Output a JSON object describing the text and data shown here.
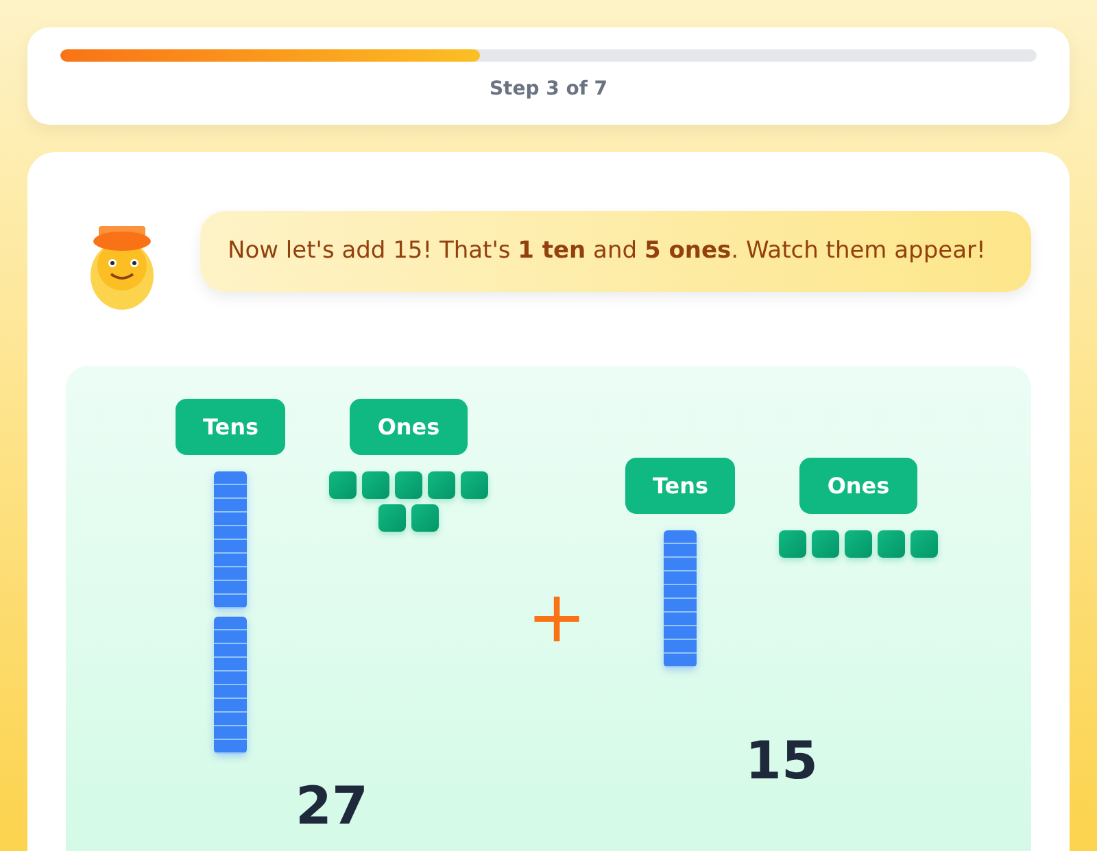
{
  "progress": {
    "level": 0.43,
    "label": "Step 3 of 7"
  },
  "message": "Now let's add 15! That's **1 ten** and **5 ones**. Watch them appear!",
  "numbers": [
    {
      "tens": {
        "label": "Tens",
        "blocks": [
          {
            "kind": "rod"
          },
          {
            "kind": "rod"
          }
        ]
      },
      "ones": {
        "label": "Ones",
        "blocks": [
          {
            "kind": "cube"
          },
          {
            "kind": "cube"
          },
          {
            "kind": "cube"
          },
          {
            "kind": "cube"
          },
          {
            "kind": "cube"
          },
          {
            "kind": "cube"
          },
          {
            "kind": "cube"
          }
        ]
      },
      "value": "27"
    },
    {
      "tens": {
        "label": "Tens",
        "blocks": [
          {
            "kind": "rod"
          }
        ]
      },
      "ones": {
        "label": "Ones",
        "blocks": [
          {
            "kind": "cube"
          },
          {
            "kind": "cube"
          },
          {
            "kind": "cube"
          },
          {
            "kind": "cube"
          },
          {
            "kind": "cube"
          }
        ]
      },
      "value": "15"
    }
  ],
  "operator": "+"
}
